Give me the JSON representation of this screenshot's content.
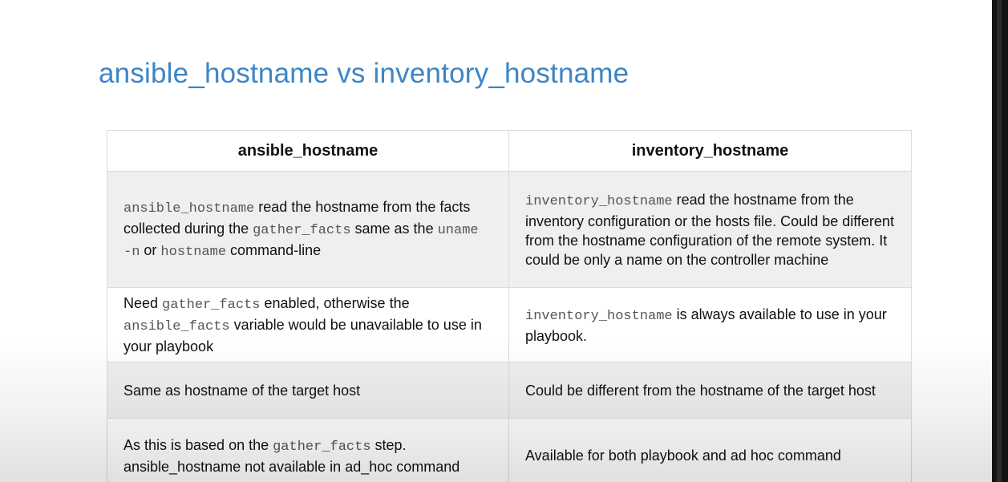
{
  "slide": {
    "title": "ansible_hostname vs  inventory_hostname"
  },
  "table": {
    "headers": [
      "ansible_hostname",
      "inventory_hostname"
    ],
    "rows": [
      {
        "left": {
          "c1": "ansible_hostname",
          "t1": " read the hostname from the facts collected during the ",
          "c2": "gather_facts",
          "t2": " same as the ",
          "c3": "uname -n",
          "t3": " or ",
          "c4": "hostname",
          "t4": " command-line"
        },
        "right": {
          "c1": "inventory_hostname",
          "t1": " read the hostname from the inventory configuration or the hosts file. Could be different from the hostname configuration of the remote system. It could be only a name on the controller machine"
        }
      },
      {
        "left": {
          "t0": "Need ",
          "c1": "gather_facts",
          "t1": " enabled, otherwise the ",
          "c2": "ansible_facts",
          "t2": " variable would be unavailable to use in your playbook"
        },
        "right": {
          "c1": "inventory_hostname",
          "t1": " is always available to use in your playbook."
        }
      },
      {
        "left": {
          "t0": "Same as hostname of the target host"
        },
        "right": {
          "t0": "Could be different from the hostname of the target host"
        }
      },
      {
        "left": {
          "t0": "As this is based on the ",
          "c1": "gather_facts",
          "t1": " step. ansible_hostname not available in ad_hoc command"
        },
        "right": {
          "t0": "Available for both playbook and ad hoc command"
        }
      }
    ]
  }
}
